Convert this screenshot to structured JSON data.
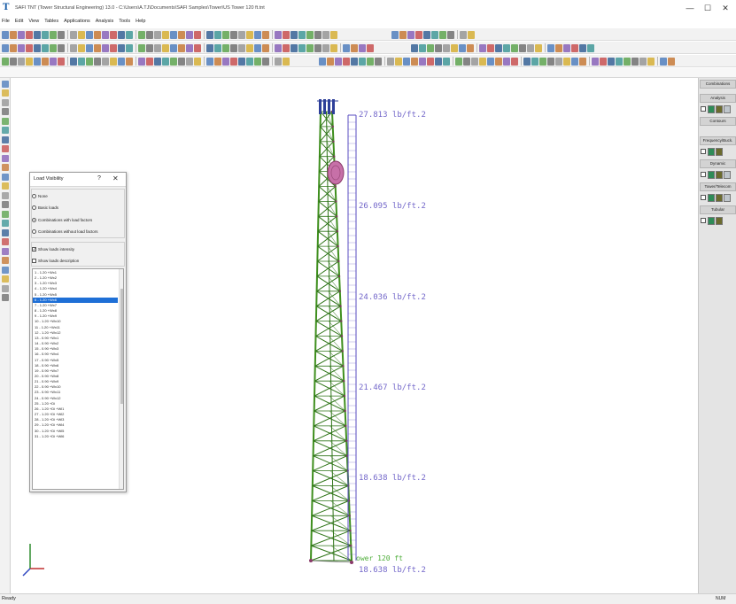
{
  "window": {
    "title": "SAFI TNT (Tower Structural Engineering) 13.0 - C:\\Users\\A.TJ\\Documents\\SAFI Samples\\Tower\\US Tower 120 ft.tnt",
    "icon": "app-logo-icon",
    "minimize": "—",
    "maximize": "☐",
    "close": "✕"
  },
  "menu": [
    {
      "label": "File"
    },
    {
      "label": "Edit"
    },
    {
      "label": "View"
    },
    {
      "label": "Tables"
    },
    {
      "label": "Applications"
    },
    {
      "label": "Analysis"
    },
    {
      "label": "Tools"
    },
    {
      "label": "Help"
    }
  ],
  "right_panel": {
    "combinations": "Combinations",
    "analysis": "Analysis",
    "contours": "Contours",
    "frequency": "Frequency/Buck.",
    "dynamic": "Dynamic",
    "tower": "Tower/Telecom",
    "tubular": "Tubular"
  },
  "load_dialog": {
    "title": "Load Visibility",
    "help": "?",
    "close": "✕",
    "radio_none": "None",
    "radio_basic": "Basic loads",
    "radio_comb_with": "Combinations with load factors",
    "radio_comb_without": "Combinations without load factors",
    "chk_intensity": "Show loads intensity",
    "chk_description": "Show loads description",
    "check_mark": "✓",
    "selected_index": 5,
    "items": [
      "1 - 1.20 +Wx1",
      "2 - 1.20 +Wx2",
      "3 - 1.20 +Wx3",
      "4 - 1.20 +Wx4",
      "5 - 1.20 +Wx5",
      "6 - 1.20 +Wx6",
      "7 - 1.20 +Wx7",
      "8 - 1.20 +Wx8",
      "9 - 1.20 +Wx9",
      "10 - 1.20 +Wx10",
      "11 - 1.20 +Wx11",
      "12 - 1.20 +Wx12",
      "13 - 0.90 +Wx1",
      "14 - 0.90 +Wx2",
      "15 - 0.90 +Wx3",
      "16 - 0.90 +Wx4",
      "17 - 0.90 +Wx5",
      "18 - 0.90 +Wx6",
      "19 - 0.90 +Wx7",
      "20 - 0.90 +Wx8",
      "21 - 0.90 +Wx9",
      "22 - 0.90 +Wx10",
      "23 - 0.90 +Wx11",
      "24 - 0.90 +Wx12",
      "25 - 1.20 +Di",
      "26 - 1.20 +Di +Wi1",
      "27 - 1.20 +Di +Wi2",
      "28 - 1.20 +Di +Wi3",
      "29 - 1.20 +Di +Wi4",
      "30 - 1.20 +Di +Wi5",
      "31 - 1.20 +Di +Wi6"
    ]
  },
  "load_labels": [
    "27.813 lb/ft.2",
    "26.095 lb/ft.2",
    "24.036 lb/ft.2",
    "21.467 lb/ft.2",
    "18.638 lb/ft.2",
    "18.638 lb/ft.2"
  ],
  "tower_label": "ower 120 ft",
  "axes_icon": "xyz-axes-icon",
  "status": {
    "text": "Ready",
    "num": "NUM"
  },
  "colors": {
    "tower_member": "#3f8f1e",
    "bracing": "#2f7518",
    "load_diagram": "#5a4cc0",
    "dish": "#c770a8",
    "antenna": "#2e3f9a",
    "selection": "#1e6fd6",
    "tower_label": "#4fae3a"
  }
}
